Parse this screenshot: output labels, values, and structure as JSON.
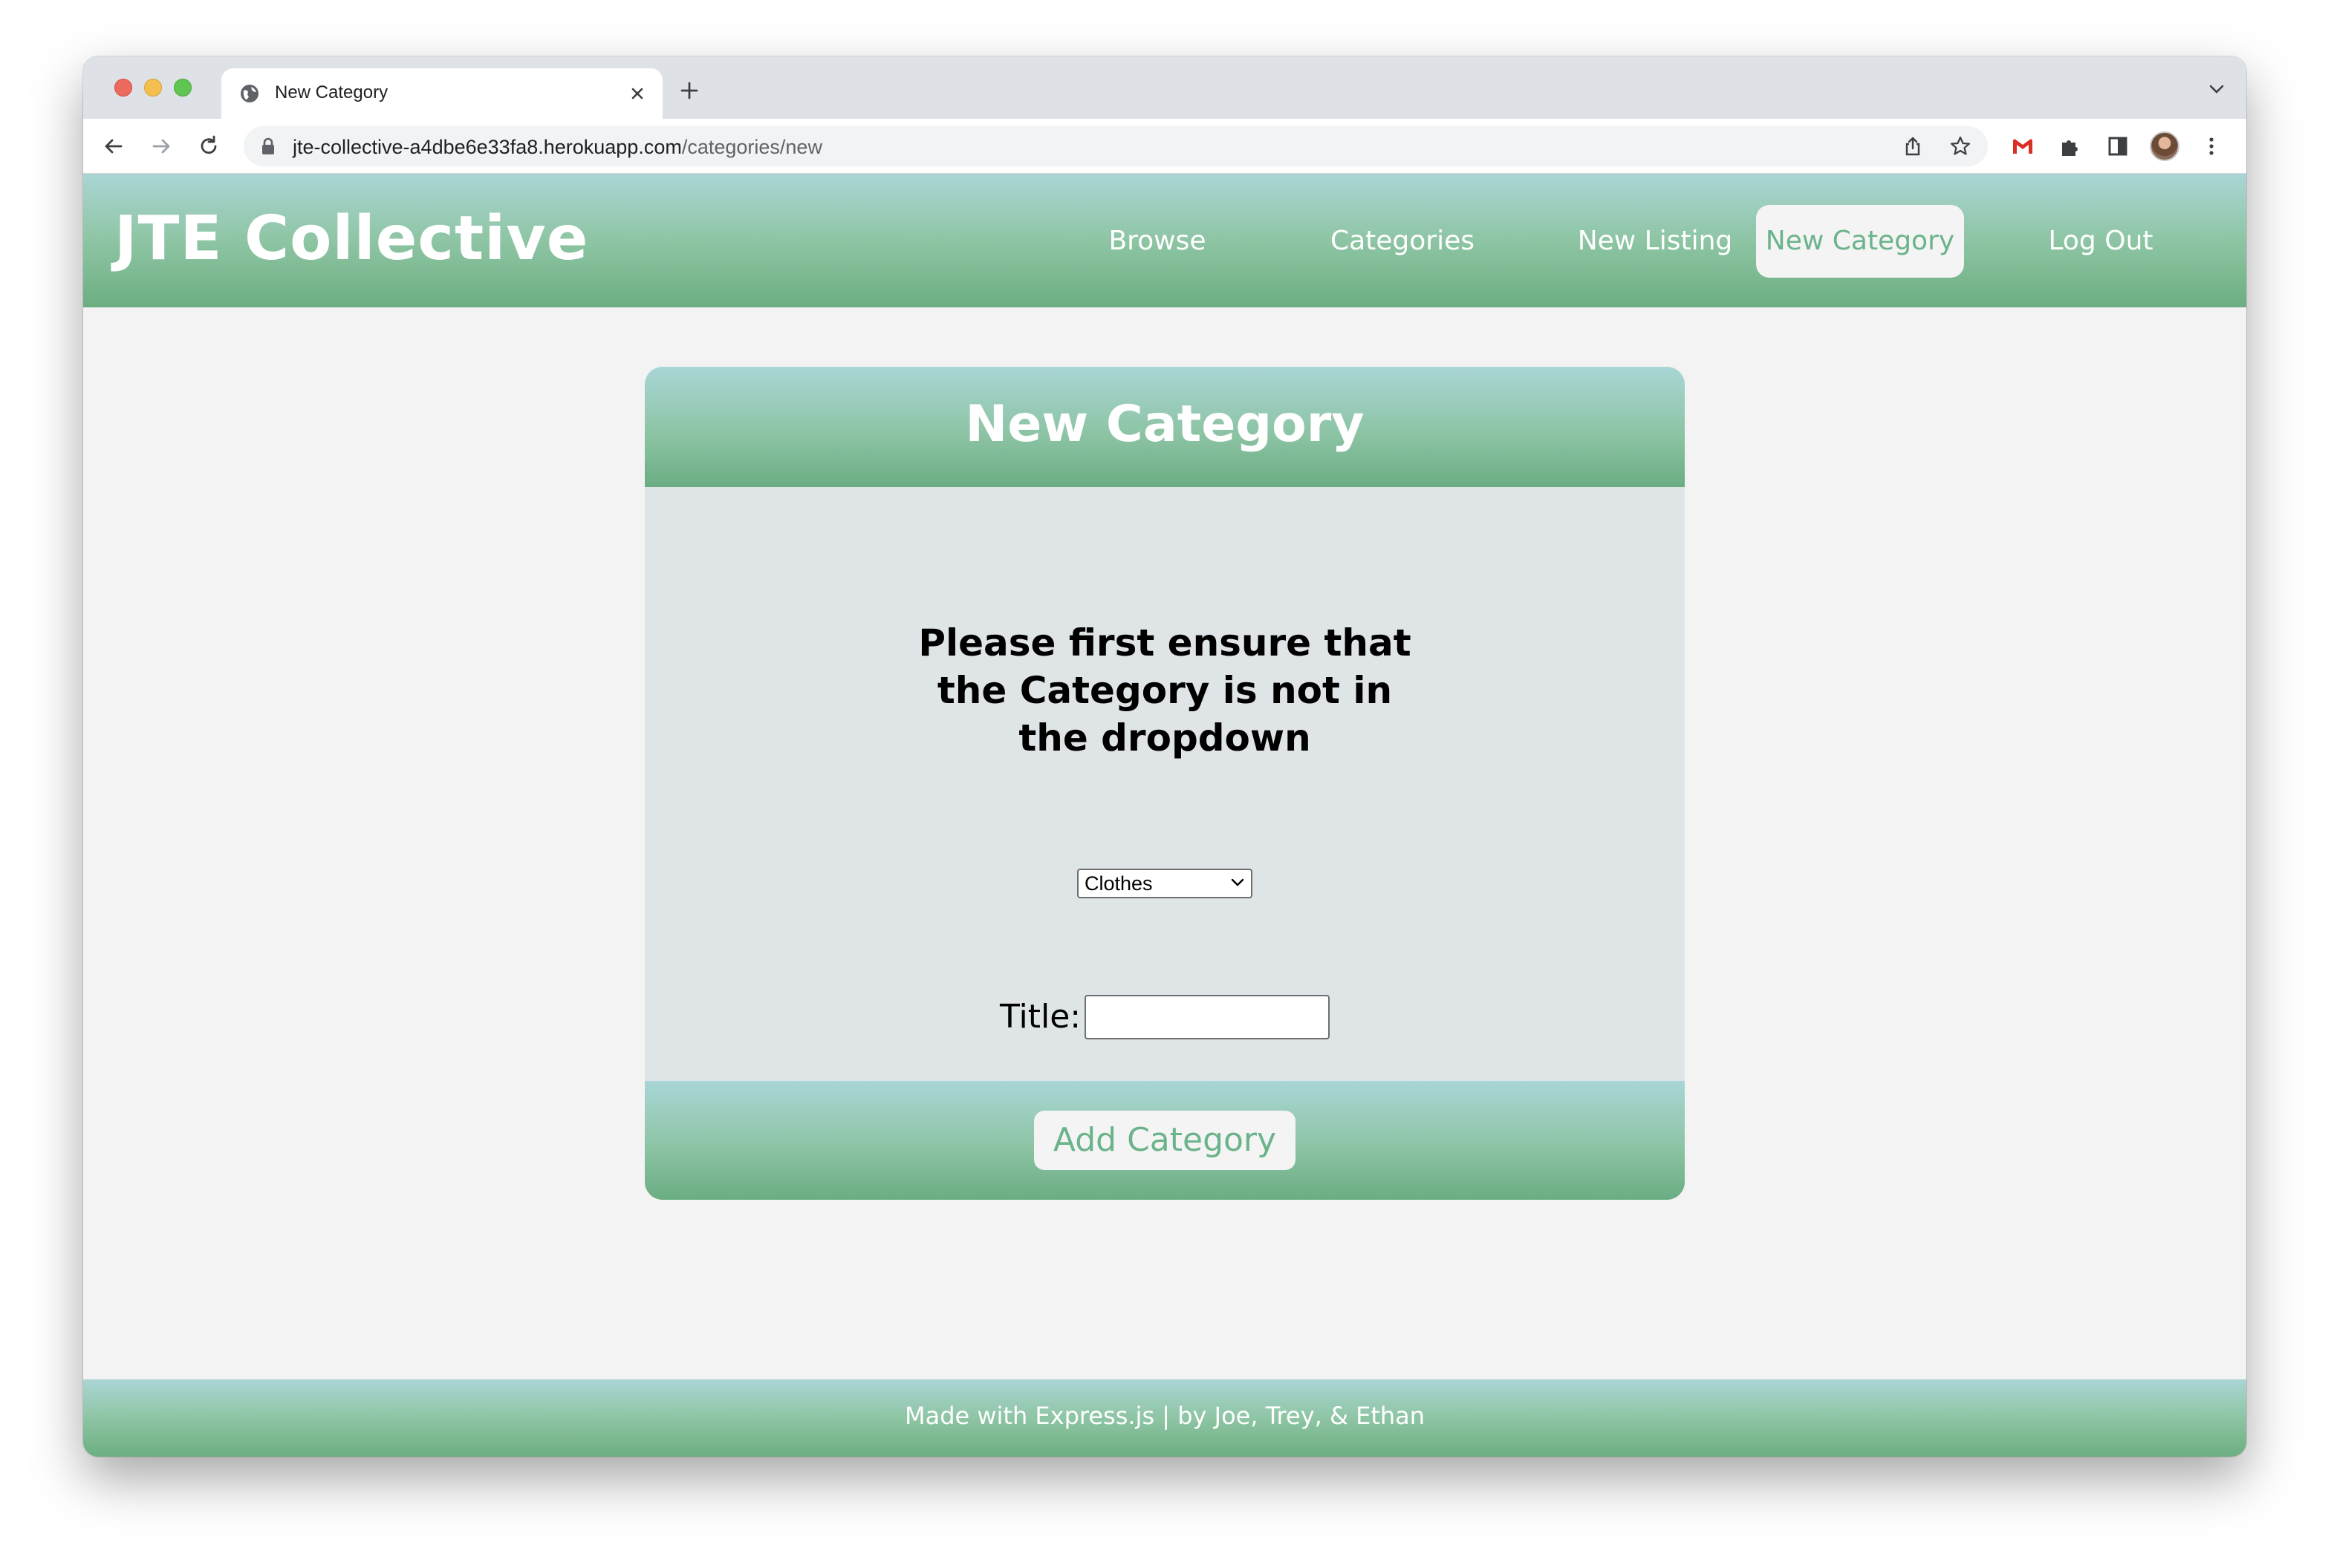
{
  "browser": {
    "tab_title": "New Category",
    "url_host": "jte-collective-a4dbe6e33fa8.herokuapp.com",
    "url_path": "/categories/new"
  },
  "site": {
    "brand": "JTE Collective",
    "nav": [
      {
        "label": "Browse",
        "active": false
      },
      {
        "label": "Categories",
        "active": false
      },
      {
        "label": "New Listing",
        "active": false
      },
      {
        "label": "New Category",
        "active": true
      },
      {
        "label": "Log Out",
        "active": false
      }
    ]
  },
  "form": {
    "heading": "New Category",
    "notice": "Please first ensure that the Category is not in the dropdown",
    "dropdown_selected": "Clothes",
    "title_label": "Title:",
    "title_value": "",
    "submit_label": "Add Category"
  },
  "footer": {
    "text": "Made with Express.js | by Joe, Trey, & Ethan"
  },
  "colors": {
    "header_gradient_top": "#aad5d5",
    "header_gradient_bottom": "#6cae82",
    "accent_green": "#6bb38a",
    "page_bg": "#f3f3f3",
    "card_body": "#dfe4e7"
  }
}
